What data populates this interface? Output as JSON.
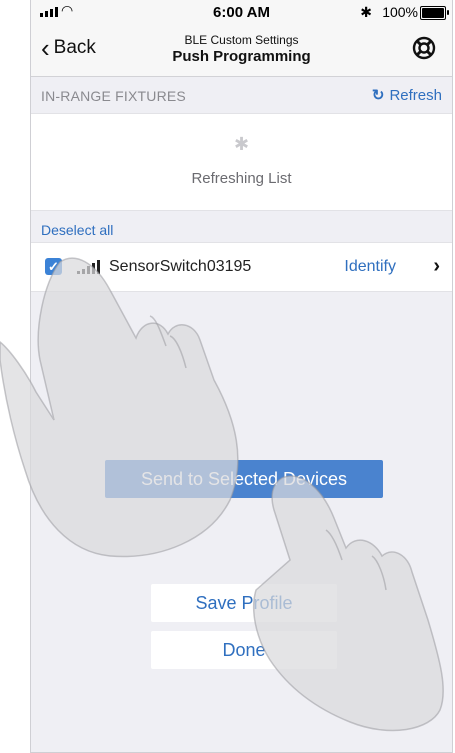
{
  "status_bar": {
    "time": "6:00 AM",
    "battery": "100%",
    "icons": [
      "signal-icon",
      "wifi-icon",
      "bluetooth-icon",
      "battery-icon"
    ]
  },
  "nav": {
    "back_label": "Back",
    "subtitle": "BLE Custom Settings",
    "title": "Push Programming",
    "help_icon": "lifebuoy-icon"
  },
  "section": {
    "header": "IN-RANGE FIXTURES",
    "refresh_label": "Refresh"
  },
  "refreshing": {
    "text": "Refreshing List",
    "icon": "bluetooth-icon"
  },
  "deselect_label": "Deselect all",
  "devices": [
    {
      "name": "SensorSwitch03195",
      "selected": true,
      "identify_label": "Identify"
    }
  ],
  "buttons": {
    "send": "Send to Selected Devices",
    "save": "Save Profile",
    "done": "Done"
  },
  "colors": {
    "accent": "#2f6fbf",
    "primary_button": "#4a83cf",
    "background": "#efeff4"
  }
}
